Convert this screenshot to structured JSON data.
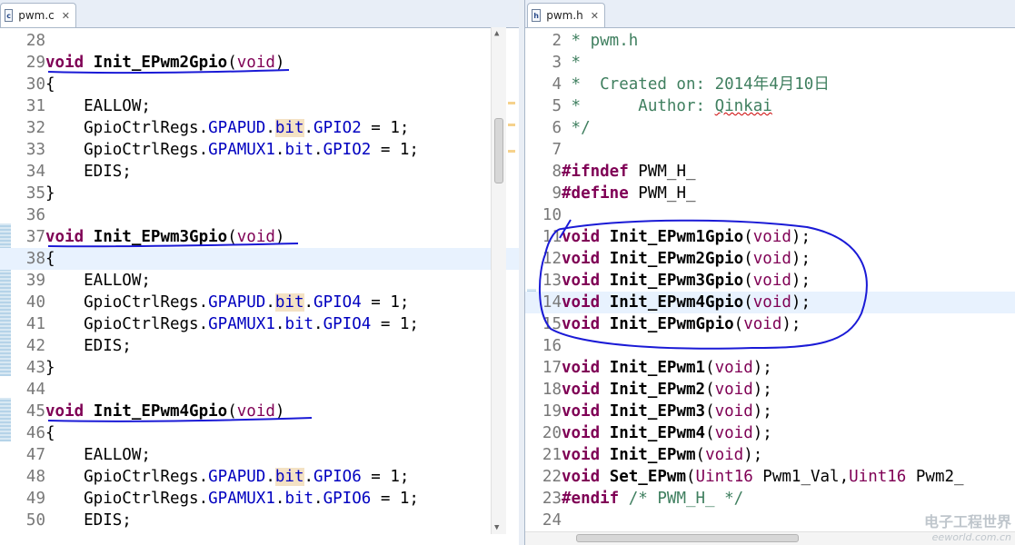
{
  "left_editor": {
    "tab_label": "pwm.c",
    "tab_icon": "c-source-file-icon",
    "lines": [
      {
        "num": "28",
        "tokens": []
      },
      {
        "num": "29",
        "tokens": [
          {
            "t": "void",
            "c": "kw"
          },
          {
            "t": " "
          },
          {
            "t": "Init_EPwm2Gpio",
            "c": "fn"
          },
          {
            "t": "("
          },
          {
            "t": "void",
            "c": "kwn"
          },
          {
            "t": ")"
          }
        ]
      },
      {
        "num": "30",
        "tokens": [
          {
            "t": "{"
          }
        ]
      },
      {
        "num": "31",
        "tokens": [
          {
            "t": "    EALLOW;"
          }
        ]
      },
      {
        "num": "32",
        "tokens": [
          {
            "t": "    GpioCtrlRegs."
          },
          {
            "t": "GPAPUD",
            "c": "fld"
          },
          {
            "t": "."
          },
          {
            "t": "bit",
            "c": "fld bit"
          },
          {
            "t": "."
          },
          {
            "t": "GPIO2",
            "c": "fld"
          },
          {
            "t": " = 1;"
          }
        ]
      },
      {
        "num": "33",
        "tokens": [
          {
            "t": "    GpioCtrlRegs."
          },
          {
            "t": "GPAMUX1",
            "c": "fld"
          },
          {
            "t": "."
          },
          {
            "t": "bit",
            "c": "fld"
          },
          {
            "t": "."
          },
          {
            "t": "GPIO2",
            "c": "fld"
          },
          {
            "t": " = 1;"
          }
        ]
      },
      {
        "num": "34",
        "tokens": [
          {
            "t": "    EDIS;"
          }
        ]
      },
      {
        "num": "35",
        "tokens": [
          {
            "t": "}"
          }
        ]
      },
      {
        "num": "36",
        "tokens": []
      },
      {
        "num": "37",
        "tokens": [
          {
            "t": "void",
            "c": "kw"
          },
          {
            "t": " "
          },
          {
            "t": "Init_EPwm3Gpio",
            "c": "fn"
          },
          {
            "t": "("
          },
          {
            "t": "void",
            "c": "kwn"
          },
          {
            "t": ")"
          }
        ]
      },
      {
        "num": "38",
        "tokens": [
          {
            "t": "{"
          }
        ],
        "hl": true
      },
      {
        "num": "39",
        "tokens": [
          {
            "t": "    EALLOW;"
          }
        ]
      },
      {
        "num": "40",
        "tokens": [
          {
            "t": "    GpioCtrlRegs."
          },
          {
            "t": "GPAPUD",
            "c": "fld"
          },
          {
            "t": "."
          },
          {
            "t": "bit",
            "c": "fld bit"
          },
          {
            "t": "."
          },
          {
            "t": "GPIO4",
            "c": "fld"
          },
          {
            "t": " = 1;"
          }
        ]
      },
      {
        "num": "41",
        "tokens": [
          {
            "t": "    GpioCtrlRegs."
          },
          {
            "t": "GPAMUX1",
            "c": "fld"
          },
          {
            "t": "."
          },
          {
            "t": "bit",
            "c": "fld"
          },
          {
            "t": "."
          },
          {
            "t": "GPIO4",
            "c": "fld"
          },
          {
            "t": " = 1;"
          }
        ]
      },
      {
        "num": "42",
        "tokens": [
          {
            "t": "    EDIS;"
          }
        ]
      },
      {
        "num": "43",
        "tokens": [
          {
            "t": "}"
          }
        ]
      },
      {
        "num": "44",
        "tokens": []
      },
      {
        "num": "45",
        "tokens": [
          {
            "t": "void",
            "c": "kw"
          },
          {
            "t": " "
          },
          {
            "t": "Init_EPwm4Gpio",
            "c": "fn"
          },
          {
            "t": "("
          },
          {
            "t": "void",
            "c": "kwn"
          },
          {
            "t": ")"
          }
        ]
      },
      {
        "num": "46",
        "tokens": [
          {
            "t": "{"
          }
        ]
      },
      {
        "num": "47",
        "tokens": [
          {
            "t": "    EALLOW;"
          }
        ]
      },
      {
        "num": "48",
        "tokens": [
          {
            "t": "    GpioCtrlRegs."
          },
          {
            "t": "GPAPUD",
            "c": "fld"
          },
          {
            "t": "."
          },
          {
            "t": "bit",
            "c": "fld bit"
          },
          {
            "t": "."
          },
          {
            "t": "GPIO6",
            "c": "fld"
          },
          {
            "t": " = 1;"
          }
        ]
      },
      {
        "num": "49",
        "tokens": [
          {
            "t": "    GpioCtrlRegs."
          },
          {
            "t": "GPAMUX1",
            "c": "fld"
          },
          {
            "t": "."
          },
          {
            "t": "bit",
            "c": "fld"
          },
          {
            "t": "."
          },
          {
            "t": "GPIO6",
            "c": "fld"
          },
          {
            "t": " = 1;"
          }
        ]
      },
      {
        "num": "50",
        "tokens": [
          {
            "t": "    EDIS;"
          }
        ]
      }
    ]
  },
  "right_editor": {
    "tab_label": "pwm.h",
    "tab_icon": "header-file-icon",
    "lines": [
      {
        "num": "2",
        "tokens": [
          {
            "t": " * pwm.h",
            "c": "cmt"
          }
        ]
      },
      {
        "num": "3",
        "tokens": [
          {
            "t": " *",
            "c": "cmt"
          }
        ]
      },
      {
        "num": "4",
        "tokens": [
          {
            "t": " *  Created on: 2014年4月10日",
            "c": "cmt"
          }
        ]
      },
      {
        "num": "5",
        "tokens": [
          {
            "t": " *      Author: ",
            "c": "cmt"
          },
          {
            "t": "Qinkai",
            "c": "cmt uline"
          }
        ]
      },
      {
        "num": "6",
        "tokens": [
          {
            "t": " */",
            "c": "cmt"
          }
        ]
      },
      {
        "num": "7",
        "tokens": []
      },
      {
        "num": "8",
        "tokens": [
          {
            "t": "#ifndef",
            "c": "pre"
          },
          {
            "t": " PWM_H_"
          }
        ]
      },
      {
        "num": "9",
        "tokens": [
          {
            "t": "#define",
            "c": "pre"
          },
          {
            "t": " PWM_H_"
          }
        ]
      },
      {
        "num": "10",
        "tokens": []
      },
      {
        "num": "11",
        "tokens": [
          {
            "t": "void",
            "c": "kw"
          },
          {
            "t": " "
          },
          {
            "t": "Init_EPwm1Gpio",
            "c": "fn"
          },
          {
            "t": "("
          },
          {
            "t": "void",
            "c": "kwn"
          },
          {
            "t": ");"
          }
        ]
      },
      {
        "num": "12",
        "tokens": [
          {
            "t": "void",
            "c": "kw"
          },
          {
            "t": " "
          },
          {
            "t": "Init_EPwm2Gpio",
            "c": "fn"
          },
          {
            "t": "("
          },
          {
            "t": "void",
            "c": "kwn"
          },
          {
            "t": ");"
          }
        ]
      },
      {
        "num": "13",
        "tokens": [
          {
            "t": "void",
            "c": "kw"
          },
          {
            "t": " "
          },
          {
            "t": "Init_EPwm3Gpio",
            "c": "fn"
          },
          {
            "t": "("
          },
          {
            "t": "void",
            "c": "kwn"
          },
          {
            "t": ");"
          }
        ]
      },
      {
        "num": "14",
        "tokens": [
          {
            "t": "void",
            "c": "kw"
          },
          {
            "t": " "
          },
          {
            "t": "Init_EPwm4Gpio",
            "c": "fn"
          },
          {
            "t": "("
          },
          {
            "t": "void",
            "c": "kwn"
          },
          {
            "t": ");"
          }
        ],
        "hl": true
      },
      {
        "num": "15",
        "tokens": [
          {
            "t": "void",
            "c": "kw"
          },
          {
            "t": " "
          },
          {
            "t": "Init_EPwmGpio",
            "c": "fn"
          },
          {
            "t": "("
          },
          {
            "t": "void",
            "c": "kwn"
          },
          {
            "t": ");"
          }
        ]
      },
      {
        "num": "16",
        "tokens": []
      },
      {
        "num": "17",
        "tokens": [
          {
            "t": "void",
            "c": "kw"
          },
          {
            "t": " "
          },
          {
            "t": "Init_EPwm1",
            "c": "fn"
          },
          {
            "t": "("
          },
          {
            "t": "void",
            "c": "kwn"
          },
          {
            "t": ");"
          }
        ]
      },
      {
        "num": "18",
        "tokens": [
          {
            "t": "void",
            "c": "kw"
          },
          {
            "t": " "
          },
          {
            "t": "Init_EPwm2",
            "c": "fn"
          },
          {
            "t": "("
          },
          {
            "t": "void",
            "c": "kwn"
          },
          {
            "t": ");"
          }
        ]
      },
      {
        "num": "19",
        "tokens": [
          {
            "t": "void",
            "c": "kw"
          },
          {
            "t": " "
          },
          {
            "t": "Init_EPwm3",
            "c": "fn"
          },
          {
            "t": "("
          },
          {
            "t": "void",
            "c": "kwn"
          },
          {
            "t": ");"
          }
        ]
      },
      {
        "num": "20",
        "tokens": [
          {
            "t": "void",
            "c": "kw"
          },
          {
            "t": " "
          },
          {
            "t": "Init_EPwm4",
            "c": "fn"
          },
          {
            "t": "("
          },
          {
            "t": "void",
            "c": "kwn"
          },
          {
            "t": ");"
          }
        ]
      },
      {
        "num": "21",
        "tokens": [
          {
            "t": "void",
            "c": "kw"
          },
          {
            "t": " "
          },
          {
            "t": "Init_EPwm",
            "c": "fn"
          },
          {
            "t": "("
          },
          {
            "t": "void",
            "c": "kwn"
          },
          {
            "t": ");"
          }
        ]
      },
      {
        "num": "22",
        "tokens": [
          {
            "t": "void",
            "c": "kw"
          },
          {
            "t": " "
          },
          {
            "t": "Set_EPwm",
            "c": "fn"
          },
          {
            "t": "("
          },
          {
            "t": "Uint16",
            "c": "kwn"
          },
          {
            "t": " Pwm1_Val,"
          },
          {
            "t": "Uint16",
            "c": "kwn"
          },
          {
            "t": " Pwm2_"
          }
        ]
      },
      {
        "num": "23",
        "tokens": [
          {
            "t": "#endif",
            "c": "pre"
          },
          {
            "t": " "
          },
          {
            "t": "/* PWM_H_ */",
            "c": "cmt"
          }
        ]
      },
      {
        "num": "24",
        "tokens": []
      }
    ]
  },
  "watermark": {
    "cn": "电子工程世界",
    "en": "eeworld.com.cn"
  },
  "colors": {
    "annotation_ink": "#1a1ad6",
    "keyword": "#7f0055",
    "field": "#0000c0",
    "comment": "#3f7f5f",
    "current_line": "#e8f2fe"
  }
}
